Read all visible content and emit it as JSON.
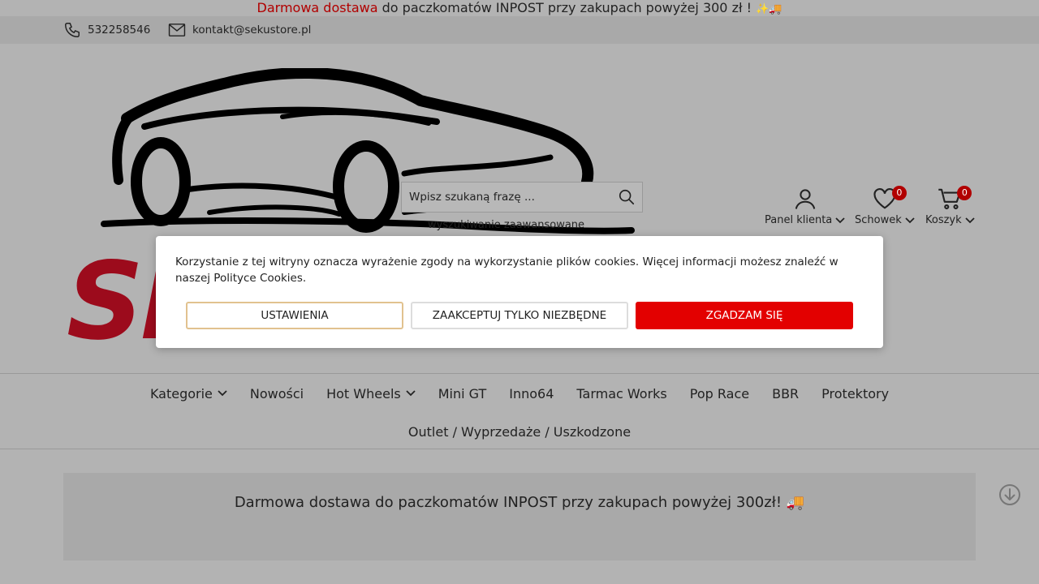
{
  "promo": {
    "highlight": "Darmowa dostawa",
    "rest": " do paczkomatów INPOST przy zakupach powyżej 300 zł ! ",
    "emoji": "✨🚚"
  },
  "contact": {
    "phone": "532258546",
    "email": "kontakt@sekustore.pl"
  },
  "logo": {
    "text": "SE"
  },
  "search": {
    "placeholder": "Wpisz szukaną frazę ...",
    "advanced": "wyszukiwanie zaawansowane"
  },
  "user_menu": {
    "panel": "Panel klienta",
    "wishlist": "Schowek",
    "wishlist_count": "0",
    "cart": "Koszyk",
    "cart_count": "0"
  },
  "nav": {
    "items": [
      {
        "label": "Kategorie"
      },
      {
        "label": "Nowości"
      },
      {
        "label": "Hot Wheels"
      },
      {
        "label": "Mini GT"
      },
      {
        "label": "Inno64"
      },
      {
        "label": "Tarmac Works"
      },
      {
        "label": "Pop Race"
      },
      {
        "label": "BBR"
      },
      {
        "label": "Protektory"
      },
      {
        "label": "Outlet / Wyprzedaże / Uszkodzone"
      }
    ]
  },
  "banner": {
    "text": "Darmowa dostawa do paczkomatów INPOST przy zakupach powyżej 300zł! 🚚"
  },
  "cookie": {
    "text": "Korzystanie z tej witryny oznacza wyrażenie zgody na wykorzystanie plików cookies. Więcej informacji możesz znaleźć w naszej Polityce Cookies.",
    "settings": "USTAWIENIA",
    "necessary": "ZAAKCEPTUJ TYLKO NIEZBĘDNE",
    "accept": "ZGADZAM SIĘ"
  },
  "colors": {
    "accent": "#b10000",
    "accept_button": "#e30000",
    "logo_red": "#9c0b1c"
  }
}
